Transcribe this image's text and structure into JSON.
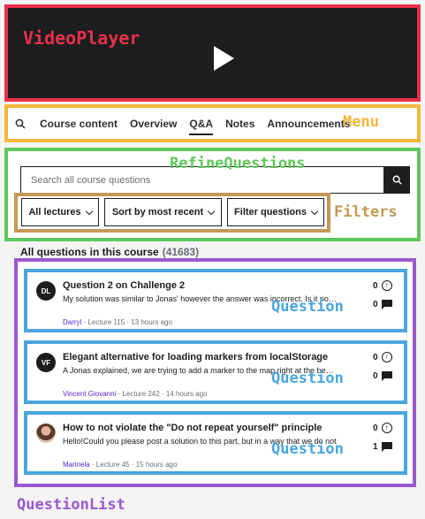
{
  "annotations": {
    "video": "VideoPlayer",
    "menu": "Menu",
    "refine": "RefineQuestions",
    "filters": "Filters",
    "question_list": "QuestionList",
    "question": "Question"
  },
  "video": {
    "play_icon": "play-icon"
  },
  "menu": {
    "search_icon": "search-icon",
    "tabs": [
      "Course content",
      "Overview",
      "Q&A",
      "Notes",
      "Announcements"
    ],
    "active_tab": "Q&A"
  },
  "search": {
    "placeholder": "Search all course questions"
  },
  "filters": {
    "lectures": "All lectures",
    "sort": "Sort by most recent",
    "filter": "Filter questions"
  },
  "list": {
    "header": "All questions in this course",
    "count": "(41683)"
  },
  "questions": [
    {
      "avatar": "DL",
      "title": "Question 2 on Challenge 2",
      "body": "My solution was similar to Jonas' however the answer was incorrect. Is it possible",
      "author": "Darryl",
      "lecture": " · Lecture 115",
      "time": " · 13 hours ago",
      "upvotes": "0",
      "replies": "0"
    },
    {
      "avatar": "VF",
      "title": "Elegant alternative for loading markers from localStorage",
      "body": "A Jonas explained, we are trying to add a marker to the map right at the beginning",
      "author": "Vincent Giovanni",
      "lecture": " · Lecture 242",
      "time": " · 14 hours ago",
      "upvotes": "0",
      "replies": "0"
    },
    {
      "avatar": "",
      "title": "How to not violate the \"Do not repeat yourself\" principle",
      "body": "Hello!Could you please post a solution to this part, but in a way that we do not",
      "author": "Marinela",
      "lecture": " · Lecture 45",
      "time": " · 15 hours ago",
      "upvotes": "0",
      "replies": "1"
    }
  ]
}
